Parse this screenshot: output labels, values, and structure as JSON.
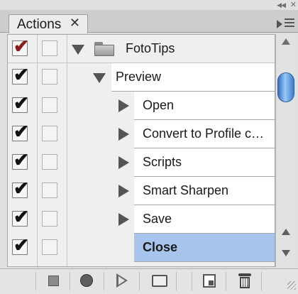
{
  "panel": {
    "tab_label": "Actions",
    "tab_close": "✕"
  },
  "rows": [
    {
      "label": "FotoTips",
      "checked": true,
      "checkColor": "#8b1a1a",
      "type": "set"
    },
    {
      "label": "Preview",
      "checked": true,
      "type": "action"
    },
    {
      "label": "Open",
      "checked": true,
      "type": "step"
    },
    {
      "label": "Convert to Profile c…",
      "checked": true,
      "type": "step"
    },
    {
      "label": "Scripts",
      "checked": true,
      "type": "step"
    },
    {
      "label": "Smart Sharpen",
      "checked": true,
      "type": "step"
    },
    {
      "label": "Save",
      "checked": true,
      "type": "step"
    },
    {
      "label": "Close",
      "checked": true,
      "type": "step",
      "selected": true
    }
  ],
  "checkmark": "✔",
  "colors": {
    "selection": "#a6c4ec",
    "scroll_thumb": "#3b7ccc",
    "set_check": "#8b1a1a"
  },
  "toolbar": {
    "icons": [
      "stop-icon",
      "record-icon",
      "play-icon",
      "new-set-folder-icon",
      "new-action-icon",
      "delete-trash-icon"
    ]
  }
}
